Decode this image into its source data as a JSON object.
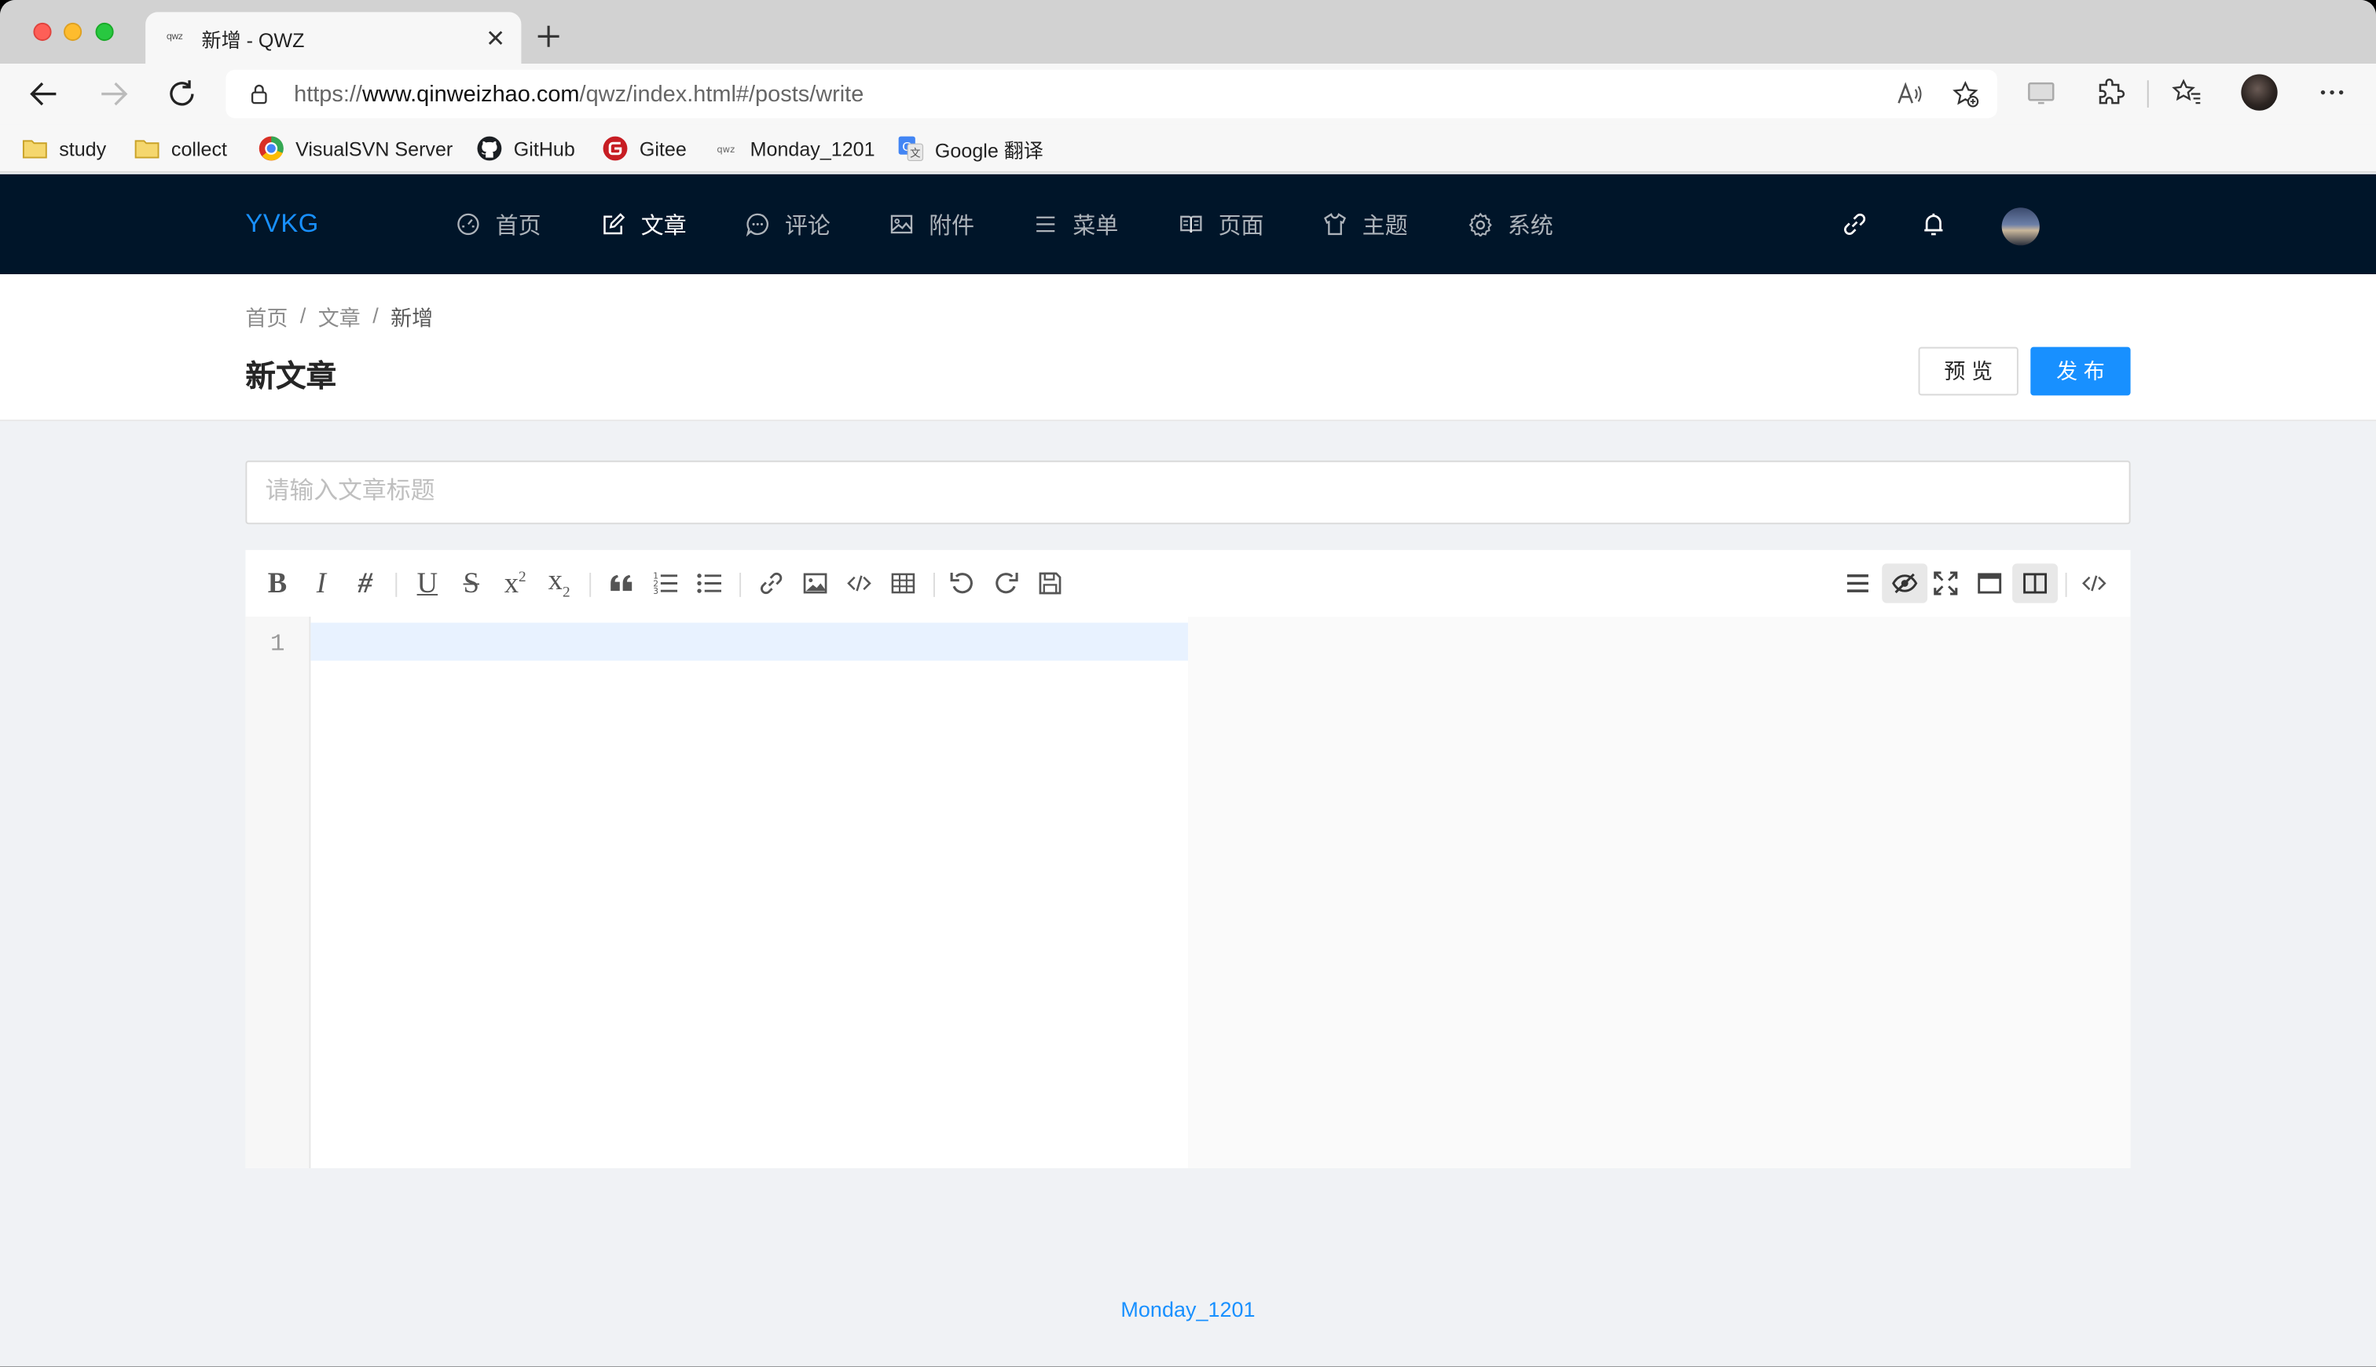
{
  "browser": {
    "tab_title": "新增 - QWZ",
    "tab_favicon_text": "qwz",
    "url_prefix": "https://",
    "url_host": "www.qinweizhao.com",
    "url_path": "/qwz/index.html#/posts/write",
    "bookmarks": [
      {
        "label": "study",
        "icon": "folder-icon"
      },
      {
        "label": "collect",
        "icon": "folder-icon"
      },
      {
        "label": "VisualSVN Server",
        "icon": "visualsvn-icon"
      },
      {
        "label": "GitHub",
        "icon": "github-icon"
      },
      {
        "label": "Gitee",
        "icon": "gitee-icon"
      },
      {
        "label": "Monday_1201",
        "icon": "qwz-icon"
      },
      {
        "label": "Google 翻译",
        "icon": "google-translate-icon"
      }
    ]
  },
  "app": {
    "brand": "YVKG",
    "nav": [
      {
        "label": "首页",
        "icon": "dashboard-icon",
        "active": false
      },
      {
        "label": "文章",
        "icon": "edit-icon",
        "active": true
      },
      {
        "label": "评论",
        "icon": "comment-icon",
        "active": false
      },
      {
        "label": "附件",
        "icon": "picture-icon",
        "active": false
      },
      {
        "label": "菜单",
        "icon": "menu-icon",
        "active": false
      },
      {
        "label": "页面",
        "icon": "read-icon",
        "active": false
      },
      {
        "label": "主题",
        "icon": "skin-icon",
        "active": false
      },
      {
        "label": "系统",
        "icon": "setting-icon",
        "active": false
      }
    ]
  },
  "page": {
    "breadcrumb": [
      "首页",
      "文章",
      "新增"
    ],
    "breadcrumb_separator": "/",
    "title": "新文章",
    "preview_label": "预览",
    "publish_label": "发布"
  },
  "editor": {
    "title_placeholder": "请输入文章标题",
    "title_value": "",
    "line_numbers": [
      "1"
    ],
    "content": "",
    "toolbar_left": [
      "bold",
      "italic",
      "heading",
      "underline",
      "strikethrough",
      "superscript",
      "subscript",
      "quote",
      "ordered-list",
      "unordered-list",
      "link",
      "image",
      "code",
      "table",
      "undo",
      "redo",
      "save"
    ],
    "toolbar_right": [
      "navigation",
      "preview-toggle",
      "fullscreen",
      "read-mode",
      "subfield",
      "html-code"
    ],
    "active_toggles": [
      "preview-toggle",
      "subfield"
    ]
  },
  "footer": {
    "text": "Monday_1201"
  },
  "colors": {
    "header_bg": "#001529",
    "brand": "#1890ff",
    "primary": "#1890ff",
    "page_bg": "#f0f2f5"
  }
}
